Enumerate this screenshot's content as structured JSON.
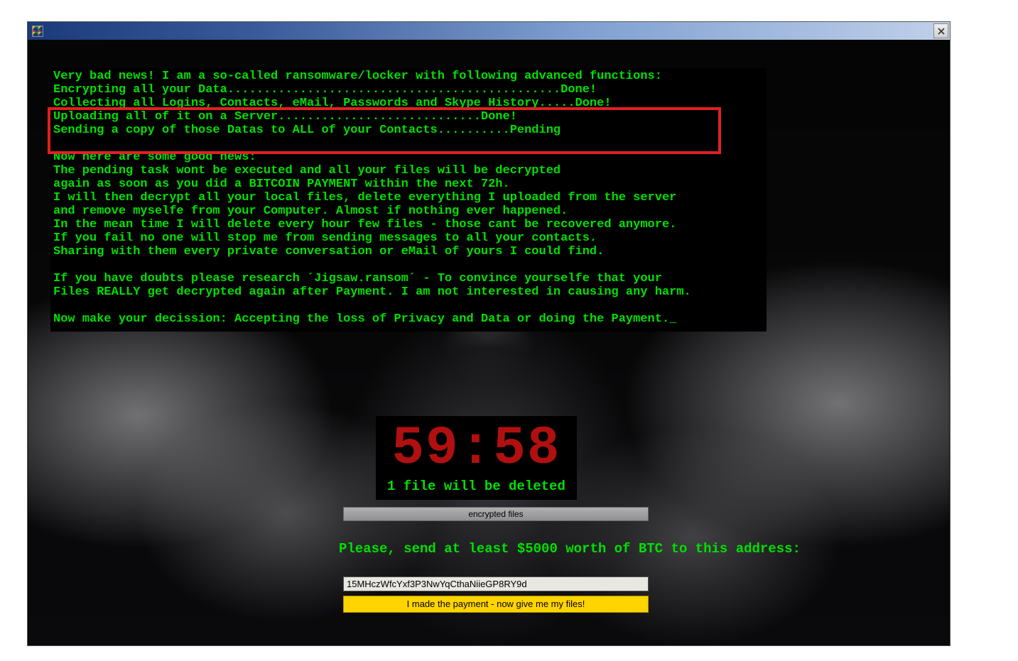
{
  "ransom": {
    "l1": "Very bad news! I am a so-called ransomware/locker with following advanced functions:",
    "l2": "Encrypting all your Data..............................................Done!",
    "l3": "Collecting all Logins, Contacts, eMail, Passwords and Skype History.....Done!",
    "l4": "Uploading all of it on a Server............................Done!",
    "l5": "Sending a copy of those Datas to ALL of your Contacts..........Pending",
    "l6": "",
    "l7": "Now here are some good news:",
    "l8": "The pending task wont be executed and all your files will be decrypted",
    "l9": "again as soon as you did a BITCOIN PAYMENT within the next 72h.",
    "l10": "I will then decrypt all your local files, delete everything I uploaded from the server",
    "l11": "and remove myselfe from your Computer. Almost if nothing ever happened.",
    "l12": "In the mean time I will delete every hour few files - those cant be recovered anymore.",
    "l13": "If you fail no one will stop me from sending messages to all your contacts.",
    "l14": "Sharing with them every private conversation or eMail of yours I could find.",
    "l15": "",
    "l16": "If you have doubts please research ´Jigsaw.ransom´ - To convince yourselfe that your",
    "l17": "Files REALLY get decrypted again after Payment. I am not interested in causing any harm.",
    "l18": "",
    "l19": "Now make your decission: Accepting the loss of Privacy and Data or doing the Payment._"
  },
  "timer": {
    "value": "59:58",
    "delete_msg": "1 file will be deleted"
  },
  "buttons": {
    "encrypted_files": "encrypted files",
    "payment": "I made the payment - now give me my files!"
  },
  "payment": {
    "send_line": "Please, send at least $5000 worth of BTC to this address:",
    "btc_address": "15MHczWfcYxf3P3NwYqCthaNiieGP8RY9d"
  }
}
